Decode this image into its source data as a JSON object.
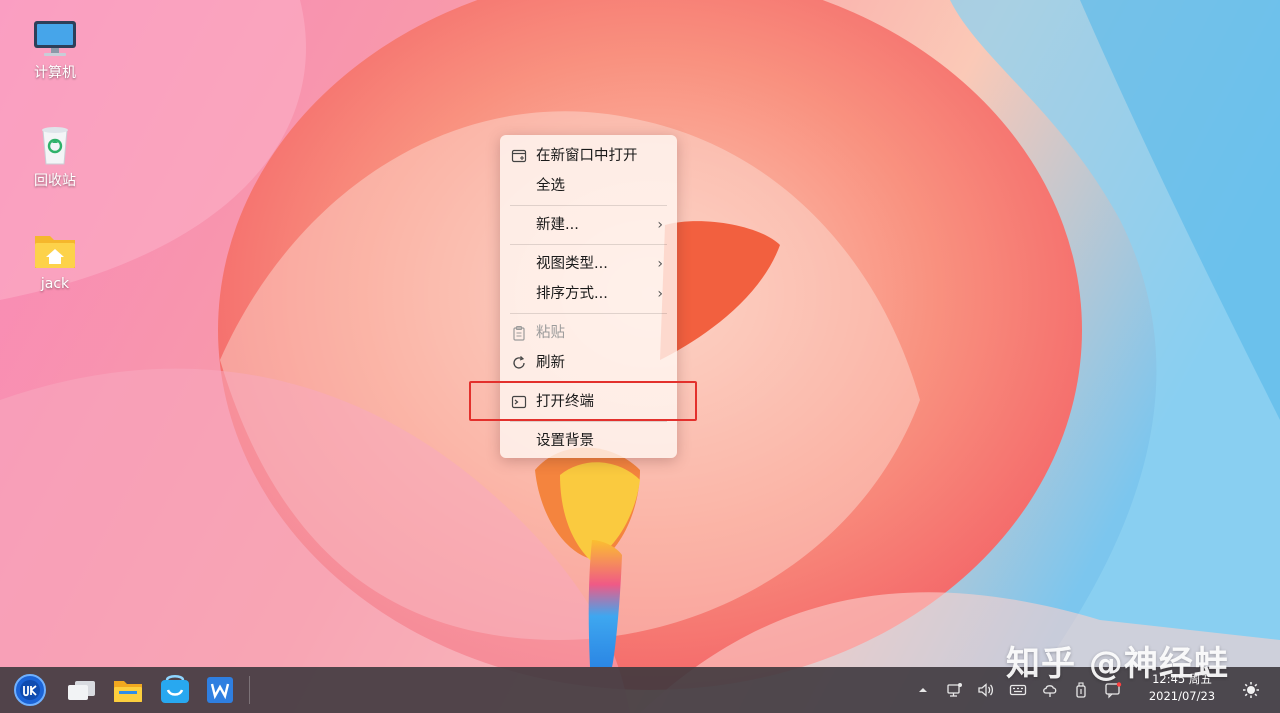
{
  "desktop": {
    "icons": [
      {
        "label": "计算机",
        "icon": "computer-icon"
      },
      {
        "label": "回收站",
        "icon": "trash-icon"
      },
      {
        "label": "jack",
        "icon": "home-folder-icon"
      }
    ]
  },
  "context_menu": {
    "items": [
      {
        "label": "在新窗口中打开",
        "icon": "new-window-icon"
      },
      {
        "label": "全选"
      },
      {
        "label": "新建...",
        "submenu": true
      },
      {
        "label": "视图类型...",
        "submenu": true
      },
      {
        "label": "排序方式...",
        "submenu": true
      },
      {
        "label": "粘贴",
        "icon": "paste-icon",
        "disabled": true
      },
      {
        "label": "刷新",
        "icon": "refresh-icon"
      },
      {
        "label": "打开终端",
        "icon": "terminal-icon",
        "highlighted": true
      },
      {
        "label": "设置背景"
      }
    ],
    "submenu_glyph": "›"
  },
  "watermark": "知乎 @神经蛙",
  "taskbar": {
    "apps": [
      "start-menu-icon",
      "multitask-view-icon",
      "file-manager-icon",
      "software-store-icon",
      "wps-icon"
    ],
    "tray": [
      "tray-expand-icon",
      "network-icon",
      "volume-icon",
      "keyboard-icon",
      "cloud-icon",
      "usb-icon",
      "notification-icon",
      "night-mode-icon"
    ],
    "clock": {
      "time": "12:45 周五",
      "date": "2021/07/23"
    }
  },
  "colors": {
    "highlight_border": "#e3302c",
    "taskbar": "#3e383e"
  }
}
